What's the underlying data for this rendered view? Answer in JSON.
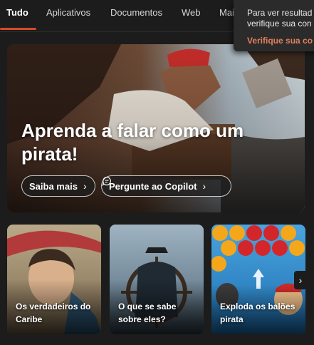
{
  "tabs": [
    {
      "label": "Tudo",
      "active": true
    },
    {
      "label": "Aplicativos"
    },
    {
      "label": "Documentos"
    },
    {
      "label": "Web"
    },
    {
      "label": "Mai"
    }
  ],
  "flyout": {
    "line1": "Para ver resultad",
    "line2": "verifique sua con",
    "link": "Verifique sua co"
  },
  "hero": {
    "title": "Aprenda a falar como um pirata!",
    "learn_more": "Saiba mais",
    "ask_copilot": "Pergunte ao Copilot"
  },
  "cards": [
    {
      "label": "Os verdadeiros do Caribe"
    },
    {
      "label": "O que se sabe sobre eles?"
    },
    {
      "label": "Exploda os balões pirata"
    }
  ],
  "colors": {
    "accent": "#d54b2a",
    "link": "#e0805c",
    "background": "#1c1c1c"
  },
  "icons": {
    "chevron": "chevron-right-icon",
    "copilot": "copilot-chat-icon"
  }
}
